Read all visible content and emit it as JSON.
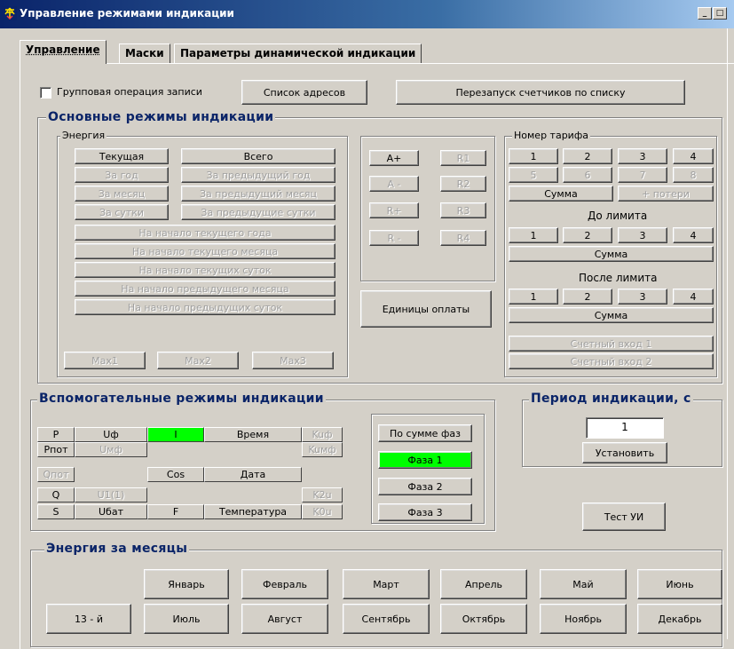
{
  "window": {
    "title": "Управление режимами индикации",
    "minimize": "_",
    "maximize": "□"
  },
  "tabs": [
    {
      "label": "Управление"
    },
    {
      "label": "Маски"
    },
    {
      "label": "Параметры динамической индикации"
    }
  ],
  "top": {
    "group_write_label": "Групповая операция записи",
    "address_list_btn": "Список адресов",
    "restart_counters_btn": "Перезапуск счетчиков по списку"
  },
  "main_modes": {
    "title": "Основные режимы индикации",
    "energy": {
      "title": "Энергия",
      "current": "Текущая",
      "total": "Всего",
      "year": "За год",
      "prev_year": "За предыдущий год",
      "month": "За месяц",
      "prev_month": "За предыдущий месяц",
      "day": "За сутки",
      "prev_days": "За предыдущие сутки",
      "start_cur_year": "На начало текущего года",
      "start_cur_month": "На начало текущего месяца",
      "start_cur_day": "На начало текущих суток",
      "start_prev_month": "На начало предыдущего месяца",
      "start_prev_day": "На начало предыдущих суток",
      "max1": "Max1",
      "max2": "Max2",
      "max3": "Max3"
    },
    "energy_types": {
      "a_plus": "A+",
      "a_minus": "A -",
      "r_plus": "R+",
      "r_minus": "R -",
      "r1": "R1",
      "r2": "R2",
      "r3": "R3",
      "r4": "R4"
    },
    "payment_units": "Единицы оплаты",
    "tariff": {
      "title": "Номер тарифа",
      "t1": "1",
      "t2": "2",
      "t3": "3",
      "t4": "4",
      "t5": "5",
      "t6": "6",
      "t7": "7",
      "t8": "8",
      "sum": "Сумма",
      "losses": "+ потери",
      "before_limit_title": "До лимита",
      "b1": "1",
      "b2": "2",
      "b3": "3",
      "b4": "4",
      "before_sum": "Сумма",
      "after_limit_title": "После лимита",
      "a1": "1",
      "a2": "2",
      "a3": "3",
      "a4": "4",
      "after_sum": "Сумма",
      "count_input_1": "Счетный вход 1",
      "count_input_2": "Счетный вход 2"
    }
  },
  "aux_modes": {
    "title": "Вспомогательные режимы индикации",
    "table": {
      "r1": [
        "P",
        "Uф",
        "I",
        "Время",
        "Kuф"
      ],
      "r2": [
        "Pпот",
        "Uмф",
        "",
        "Kuмф"
      ],
      "r3": [
        "Qпот",
        "Cos",
        "Дата"
      ],
      "r4": [
        "Q",
        "U1(1)",
        "K2u"
      ],
      "r5": [
        "S",
        "Uбат",
        "F",
        "Температура",
        "K0u"
      ]
    },
    "by_phase_sum": "По сумме фаз",
    "phase1": "Фаза 1",
    "phase2": "Фаза 2",
    "phase3": "Фаза 3"
  },
  "period": {
    "title": "Период индикации, с",
    "value": "1",
    "set_btn": "Установить"
  },
  "ui_test_btn": "Тест УИ",
  "months_group": {
    "title": "Энергия за месяцы",
    "jan": "Январь",
    "feb": "Февраль",
    "mar": "Март",
    "apr": "Апрель",
    "may": "Май",
    "jun": "Июнь",
    "m13": "13 - й",
    "jul": "Июль",
    "aug": "Август",
    "sep": "Сентябрь",
    "oct": "Октябрь",
    "nov": "Ноябрь",
    "dec": "Декабрь"
  },
  "colors": {
    "title_bar": "#0a246a",
    "group_title": "#0a2468",
    "active_green": "#00ff00",
    "face": "#d4d0c8"
  }
}
